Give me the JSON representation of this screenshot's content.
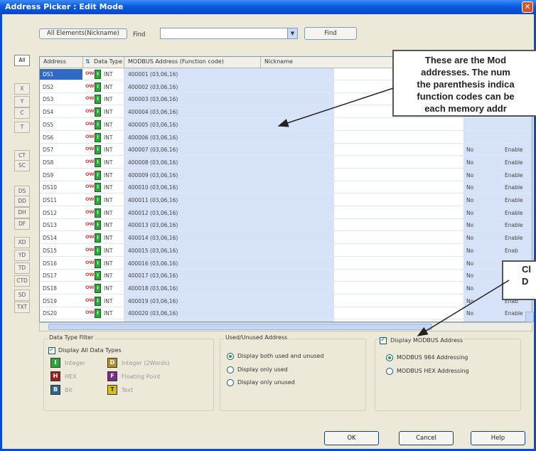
{
  "window": {
    "title": "Address Picker : Edit Mode",
    "close_glyph": "✕"
  },
  "toolbar": {
    "mode_button": "All Elements(Nickname)",
    "find_label": "Find",
    "find_button": "Find",
    "find_value": ""
  },
  "sidebar": {
    "tabs": [
      "All",
      "X",
      "Y",
      "C",
      "T",
      "CT",
      "SC",
      "DS",
      "DD",
      "DH",
      "DF",
      "XD",
      "YD",
      "TD",
      "CTD",
      "SD",
      "TXT"
    ]
  },
  "grid": {
    "headers": [
      "Address",
      "Data Type",
      "MODBUS Address (Function code)",
      "Nickname"
    ],
    "rows": [
      {
        "address": "DS1",
        "type": "INT",
        "modbus": "400001 (03,06,16)"
      },
      {
        "address": "DS2",
        "type": "INT",
        "modbus": "400002 (03,06,16)"
      },
      {
        "address": "DS3",
        "type": "INT",
        "modbus": "400003 (03,06,16)"
      },
      {
        "address": "DS4",
        "type": "INT",
        "modbus": "400004 (03,06,16)"
      },
      {
        "address": "DS5",
        "type": "INT",
        "modbus": "400005 (03,06,16)"
      },
      {
        "address": "DS6",
        "type": "INT",
        "modbus": "400006 (03,06,16)"
      },
      {
        "address": "DS7",
        "type": "INT",
        "modbus": "400007 (03,06,16)",
        "used": "No",
        "state": "Enable"
      },
      {
        "address": "DS8",
        "type": "INT",
        "modbus": "400008 (03,06,16)",
        "used": "No",
        "state": "Enable"
      },
      {
        "address": "DS9",
        "type": "INT",
        "modbus": "400009 (03,06,16)",
        "used": "No",
        "state": "Enable"
      },
      {
        "address": "DS10",
        "type": "INT",
        "modbus": "400010 (03,06,16)",
        "used": "No",
        "state": "Enable"
      },
      {
        "address": "DS11",
        "type": "INT",
        "modbus": "400011 (03,06,16)",
        "used": "No",
        "state": "Enable"
      },
      {
        "address": "DS12",
        "type": "INT",
        "modbus": "400012 (03,06,16)",
        "used": "No",
        "state": "Enable"
      },
      {
        "address": "DS13",
        "type": "INT",
        "modbus": "400013 (03,06,16)",
        "used": "No",
        "state": "Enable"
      },
      {
        "address": "DS14",
        "type": "INT",
        "modbus": "400014 (03,06,16)",
        "used": "No",
        "state": "Enable"
      },
      {
        "address": "DS15",
        "type": "INT",
        "modbus": "400015 (03,06,16)",
        "used": "No",
        "state": "Enab"
      },
      {
        "address": "DS16",
        "type": "INT",
        "modbus": "400016 (03,06,16)",
        "used": "No",
        "state": "Enab"
      },
      {
        "address": "DS17",
        "type": "INT",
        "modbus": "400017 (03,06,16)",
        "used": "No",
        "state": "Enab"
      },
      {
        "address": "DS18",
        "type": "INT",
        "modbus": "400018 (03,06,16)",
        "used": "No",
        "state": "Enab"
      },
      {
        "address": "DS19",
        "type": "INT",
        "modbus": "400019 (03,06,16)",
        "used": "No",
        "state": "Enab"
      },
      {
        "address": "DS20",
        "type": "INT",
        "modbus": "400020 (03,06,16)",
        "used": "No",
        "state": "Enable"
      }
    ],
    "row_overwrite": "OW"
  },
  "filters": {
    "data_type_title": "Data Type Filter",
    "display_all": "Display All Data Types",
    "types": [
      "Integer",
      "Integer (2Words)",
      "HEX",
      "Floating Point",
      "Bit",
      "Text"
    ],
    "used_title": "Used/Unused Address",
    "used_opts": [
      "Display both used and unused",
      "Display only used",
      "Display only unused"
    ],
    "modbus_check": "Display MODBUS Address",
    "modbus_opts": [
      "MODBUS 984 Addressing",
      "MODBUS HEX Addressing"
    ]
  },
  "buttons": {
    "ok": "OK",
    "cancel": "Cancel",
    "help": "Help"
  },
  "callout1": {
    "lines": [
      "These are the Mod",
      "addresses.  The num",
      "the parenthesis indica",
      "function codes can be",
      "each memory addr"
    ]
  },
  "callout2": {
    "lines": [
      "Cl",
      "D"
    ]
  }
}
